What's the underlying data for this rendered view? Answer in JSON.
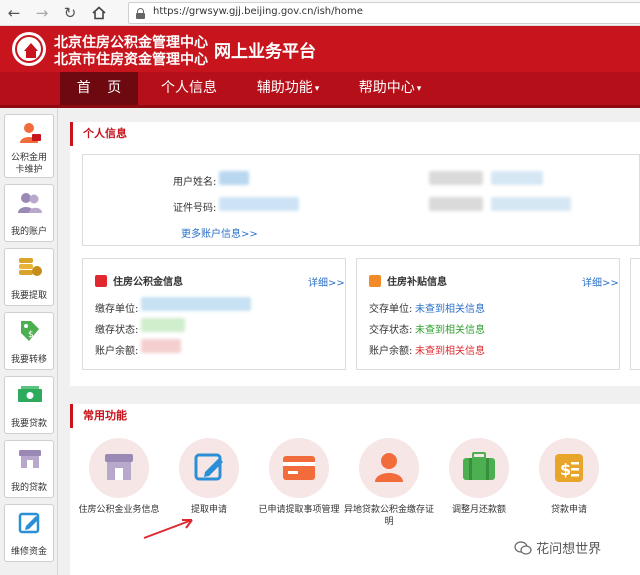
{
  "browser": {
    "url": "https://grwsyw.gjj.beijing.gov.cn/ish/home"
  },
  "header": {
    "org_line1": "北京住房公积金管理中心",
    "org_line2": "北京市住房资金管理中心",
    "platform_title": "网上业务平台"
  },
  "nav": {
    "items": [
      {
        "label": "首 页"
      },
      {
        "label": "个人信息"
      },
      {
        "label": "辅助功能"
      },
      {
        "label": "帮助中心"
      }
    ]
  },
  "sidebar": {
    "items": [
      {
        "label1": "公积金用",
        "label2": "卡维护"
      },
      {
        "label1": "我的账户"
      },
      {
        "label1": "我要提取"
      },
      {
        "label1": "我要转移"
      },
      {
        "label1": "我要贷款"
      },
      {
        "label1": "我的贷款"
      },
      {
        "label1": "维修资金"
      }
    ]
  },
  "personal_info": {
    "title": "个人信息",
    "name_label": "用户姓名:",
    "id_label": "证件号码:",
    "more_link": "更多账户信息>>"
  },
  "fund_card": {
    "title": "住房公积金信息",
    "detail_link": "详细>>",
    "rows": [
      {
        "label": "缴存单位:"
      },
      {
        "label": "缴存状态:"
      },
      {
        "label": "账户余额:"
      }
    ]
  },
  "subsidy_card": {
    "title": "住房补贴信息",
    "detail_link": "详细>>",
    "rows": [
      {
        "label": "交存单位:",
        "value": "未查到相关信息"
      },
      {
        "label": "交存状态:",
        "value": "未查到相关信息"
      },
      {
        "label": "账户余额:",
        "value": "未查到相关信息"
      }
    ]
  },
  "common_functions": {
    "title": "常用功能",
    "items": [
      {
        "label": "住房公积金业务信息",
        "icon": "storefront-icon"
      },
      {
        "label": "提取申请",
        "icon": "edit-icon"
      },
      {
        "label": "已申请提取事项管理",
        "icon": "card-icon"
      },
      {
        "label": "异地贷款公积金缴存证明",
        "icon": "person-icon"
      },
      {
        "label": "调整月还款额",
        "icon": "briefcase-icon"
      },
      {
        "label": "贷款申请",
        "icon": "money-icon"
      }
    ]
  },
  "watermark": "花问想世界",
  "colors": {
    "brand_red": "#c8141c",
    "nav_active": "#6e0910",
    "link_blue": "#2a6fc9",
    "status_green": "#2ca02c",
    "status_red": "#e0282e"
  }
}
